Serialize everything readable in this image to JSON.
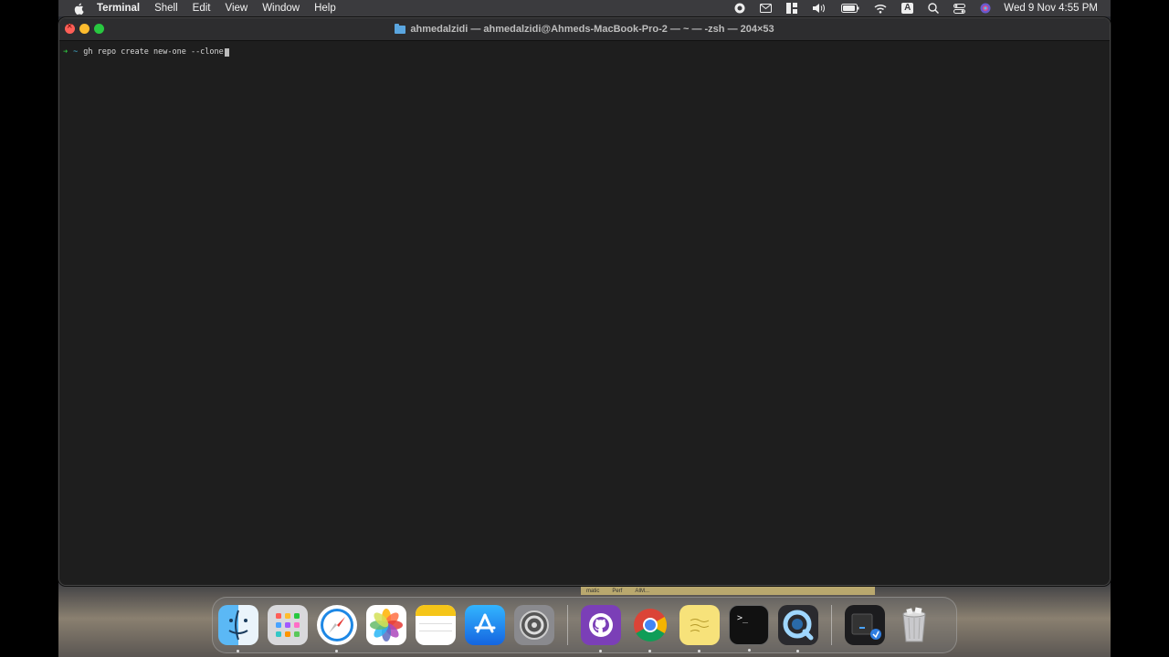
{
  "menubar": {
    "app_name": "Terminal",
    "menus": [
      "Shell",
      "Edit",
      "View",
      "Window",
      "Help"
    ],
    "status_icons": [
      "record-icon",
      "mail-icon",
      "window-tiling-icon",
      "volume-icon",
      "battery-icon",
      "wifi-icon",
      "input-source-icon",
      "spotlight-search-icon",
      "control-center-icon",
      "siri-icon"
    ],
    "input_source_label": "A",
    "clock": "Wed 9 Nov  4:55 PM"
  },
  "window": {
    "title": "ahmedalzidi — ahmedalzidi@Ahmeds-MacBook-Pro-2 — ~ — -zsh — 204×53"
  },
  "terminal": {
    "prompt_arrow": "➜",
    "prompt_dir": "~",
    "command": "gh repo create new-one --clone"
  },
  "background_strip": {
    "labels": [
      "matic",
      "Perf",
      "AIM..."
    ]
  },
  "dock": {
    "apps": [
      {
        "name": "finder-app",
        "running": true
      },
      {
        "name": "launchpad-app",
        "running": false
      },
      {
        "name": "safari-app",
        "running": true
      },
      {
        "name": "photos-app",
        "running": false
      },
      {
        "name": "notes-app",
        "running": true
      },
      {
        "name": "app-store-app",
        "running": false
      },
      {
        "name": "system-settings-app",
        "running": false
      },
      {
        "name": "github-desktop-app",
        "running": true
      },
      {
        "name": "chrome-app",
        "running": true
      },
      {
        "name": "stickies-app",
        "running": true
      },
      {
        "name": "terminal-app",
        "running": true
      },
      {
        "name": "quicktime-app",
        "running": true
      },
      {
        "name": "downloads-stack",
        "running": false
      },
      {
        "name": "trash",
        "running": false
      }
    ]
  },
  "colors": {
    "terminal_bg": "#1e1e1e",
    "prompt_arrow": "#2ecc40",
    "prompt_dir": "#44b4d6",
    "close": "#ff5f57",
    "minimize": "#febc2e",
    "zoom": "#28c840"
  }
}
